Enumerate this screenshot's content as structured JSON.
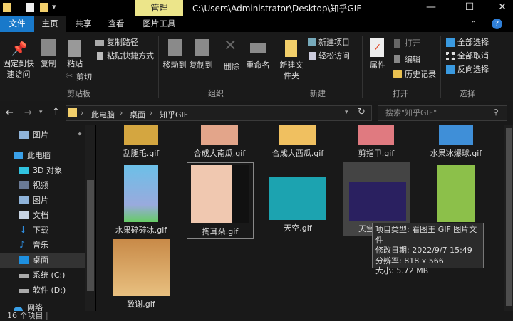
{
  "title_bar": {
    "manage_tab": "管理",
    "path": "C:\\Users\\Administrator\\Desktop\\知乎GIF",
    "minimize": "—",
    "maximize": "☐",
    "close": "✕"
  },
  "ribbon_tabs": [
    "文件",
    "主页",
    "共享",
    "查看",
    "图片工具"
  ],
  "ribbon": {
    "clipboard": {
      "pin": "固定到快速访问",
      "copy": "复制",
      "paste": "粘贴",
      "copy_path": "复制路径",
      "paste_shortcut": "粘贴快捷方式",
      "cut": "剪切",
      "label": "剪贴板"
    },
    "organize": {
      "move_to": "移动到",
      "copy_to": "复制到",
      "delete": "删除",
      "rename": "重命名",
      "label": "组织"
    },
    "new": {
      "new_folder": "新建文件夹",
      "new_item": "新建项目",
      "easy_access": "轻松访问",
      "label": "新建"
    },
    "open": {
      "properties": "属性",
      "open": "打开",
      "edit": "编辑",
      "history": "历史记录",
      "label": "打开"
    },
    "select": {
      "select_all": "全部选择",
      "select_none": "全部取消",
      "invert": "反向选择",
      "label": "选择"
    }
  },
  "breadcrumb": [
    "此电脑",
    "桌面",
    "知乎GIF"
  ],
  "search": {
    "placeholder": "搜索\"知乎GIF\""
  },
  "nav": [
    {
      "label": "图片",
      "color": "#8fb3d9"
    },
    {
      "label": "此电脑",
      "color": "#3aa0e8"
    },
    {
      "label": "3D 对象",
      "color": "#31c3e0"
    },
    {
      "label": "视频",
      "color": "#6a7a95"
    },
    {
      "label": "图片",
      "color": "#8fb3d9"
    },
    {
      "label": "文档",
      "color": "#c7d3e3"
    },
    {
      "label": "下载",
      "color": "#2f8ee0"
    },
    {
      "label": "音乐",
      "color": "#2f8ee0"
    },
    {
      "label": "桌面",
      "color": "#1e90e0"
    },
    {
      "label": "系统 (C:)",
      "color": "#aaa"
    },
    {
      "label": "软件 (D:)",
      "color": "#aaa"
    },
    {
      "label": "网络",
      "color": "#3aa0e8"
    }
  ],
  "files": [
    {
      "name": "刮腿毛.gif",
      "color": "#d4a640"
    },
    {
      "name": "合成大南瓜.gif",
      "color": "#e3a58a"
    },
    {
      "name": "合成大西瓜.gif",
      "color": "#f0c060"
    },
    {
      "name": "剪指甲.gif",
      "color": "#e07a80"
    },
    {
      "name": "水果冰爆球.gif",
      "color": "#3f8fd8"
    },
    {
      "name": "水果碎碎冰.gif",
      "color": "#6cc0e8"
    },
    {
      "name": "掏耳朵.gif",
      "color": "#f0c8b0"
    },
    {
      "name": "天空.gif",
      "color": "#1ca3b0"
    },
    {
      "name": "天空",
      "color": "#2a2060"
    },
    {
      "name": "",
      "color": "#8cc04a"
    },
    {
      "name": "致谢.gif",
      "color": "#c88a48"
    }
  ],
  "tooltip": {
    "type": "项目类型: 看图王 GIF 图片文件",
    "modified": "修改日期: 2022/9/7 15:49",
    "resolution": "分辨率: 818 x 566",
    "size": "大小: 5.72 MB"
  },
  "status": {
    "count": "16 个项目"
  }
}
